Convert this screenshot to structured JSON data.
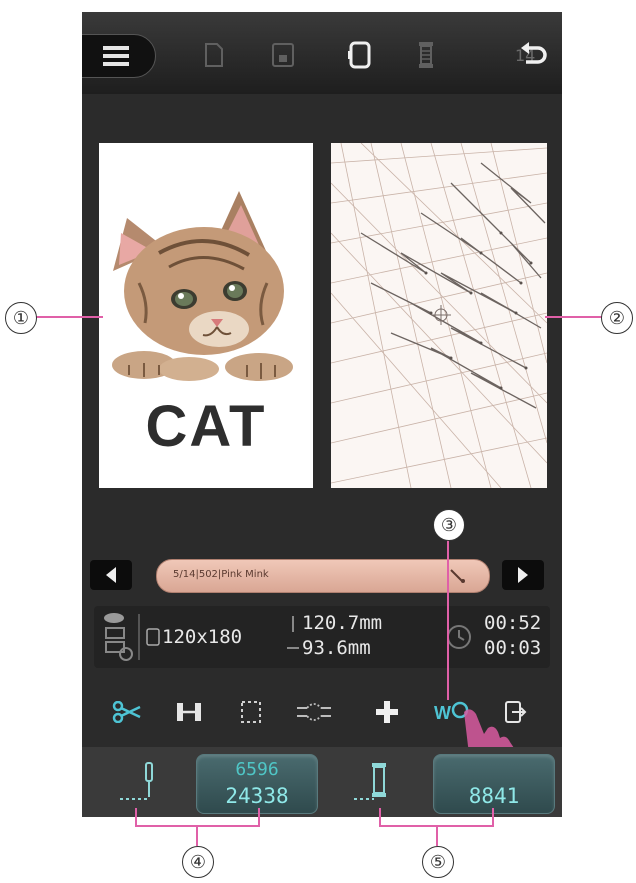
{
  "toolbar": {
    "menu_icon": "hamburger-icon",
    "items": [
      "new-file-icon",
      "save-icon",
      "hoop-icon",
      "thread-spool-icon",
      "undo-icon"
    ],
    "thread_count": "14"
  },
  "preview": {
    "design_text": "CAT"
  },
  "thread_bar": {
    "label": "5/14|502|Pink Mink"
  },
  "info": {
    "hoop_size": "120x180",
    "width": "120.7mm",
    "height": "93.6mm",
    "time_total": "00:52",
    "time_remaining": "00:03"
  },
  "functions": [
    "scissors-icon",
    "frame-icon",
    "trace-icon",
    "jump-icon",
    "move-icon",
    "jump-stitch-icon",
    "exit-icon"
  ],
  "counters": {
    "stitch_current": "6596",
    "stitch_total": "24338",
    "color_current": "",
    "color_total": "8841"
  },
  "callouts": [
    "①",
    "②",
    "③",
    "④",
    "⑤"
  ],
  "colors": {
    "accent": "#e060a8",
    "counter_text": "#8fe8e8",
    "screen_bg": "#2b2b2b"
  }
}
